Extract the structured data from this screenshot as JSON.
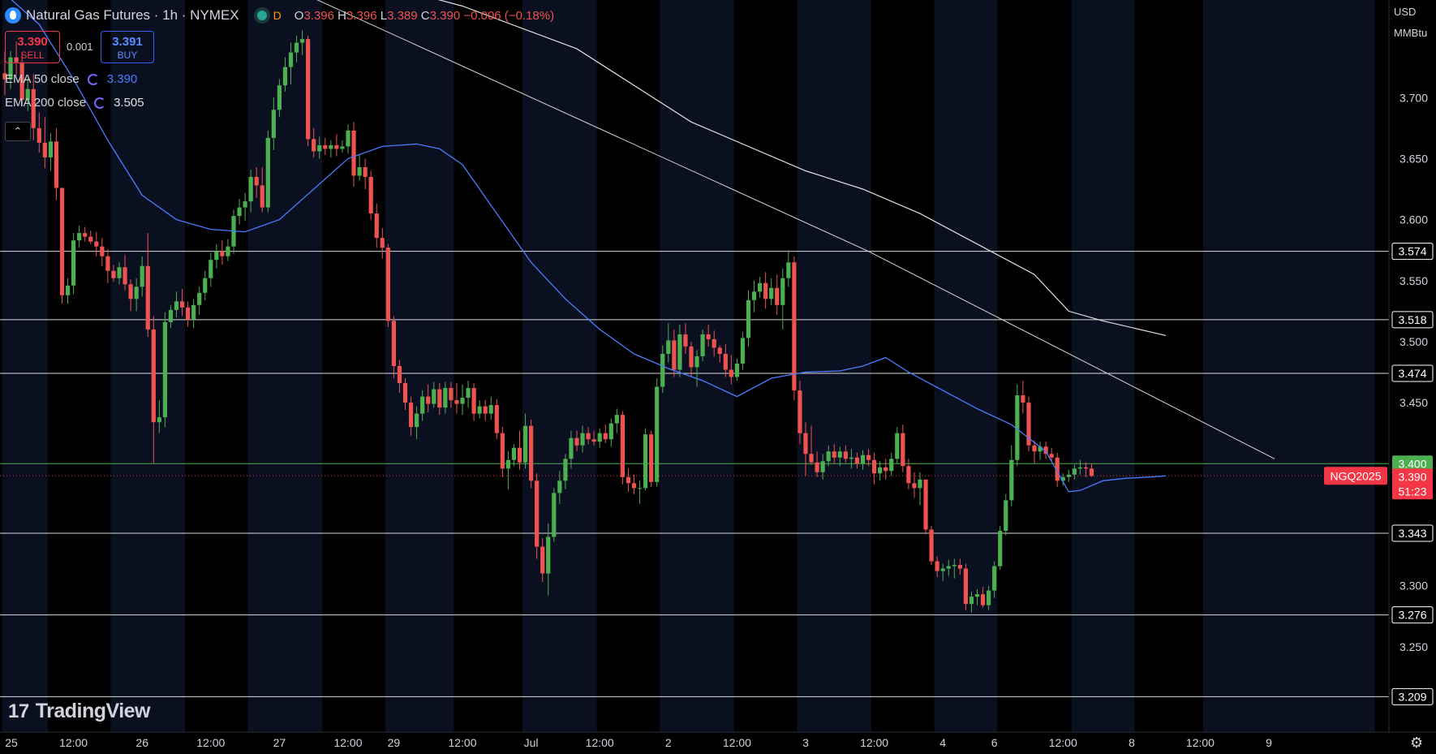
{
  "header": {
    "title": "Natural Gas Futures · 1h · NYMEX",
    "interval_badge": "D",
    "open_label": "O",
    "open": "3.396",
    "high_label": "H",
    "high": "3.396",
    "low_label": "L",
    "low": "3.389",
    "close_label": "C",
    "close": "3.390",
    "change": "−0.006 (−0.18%)"
  },
  "trade": {
    "sell_price": "3.390",
    "sell_label": "SELL",
    "spread": "0.001",
    "buy_price": "3.391",
    "buy_label": "BUY"
  },
  "indicators": [
    {
      "name": "EMA 50 close",
      "value": "3.390",
      "color": "#4a7dff"
    },
    {
      "name": "EMA 200 close",
      "value": "3.505",
      "color": "#e0e0e0"
    }
  ],
  "collapse_icon": "chevron-up-icon",
  "currency": "USD",
  "unit": "MMBtu",
  "watermark": "TradingView",
  "settings_icon": "gear-icon",
  "colors": {
    "up": "#26a69a",
    "up_body": "#4caf50",
    "down": "#ef5350",
    "session_bg": "#0b1020",
    "background": "#000000",
    "hline": "#ffffff",
    "current_line": "#4caf50",
    "last_price": "#f23645"
  },
  "chart_data": {
    "type": "candlestick",
    "symbol": "NGQ2025",
    "ylim": [
      3.18,
      3.78
    ],
    "y_ticks": [
      "3.700",
      "3.650",
      "3.600",
      "3.550",
      "3.500",
      "3.450",
      "3.300",
      "3.250"
    ],
    "x_ticks": [
      {
        "label": "25",
        "h": 0
      },
      {
        "label": "12:00",
        "h": 12
      },
      {
        "label": "26",
        "h": 24
      },
      {
        "label": "12:00",
        "h": 36
      },
      {
        "label": "27",
        "h": 48
      },
      {
        "label": "12:00",
        "h": 60
      },
      {
        "label": "29",
        "h": 68
      },
      {
        "label": "12:00",
        "h": 80
      },
      {
        "label": "Jul",
        "h": 92
      },
      {
        "label": "12:00",
        "h": 104
      },
      {
        "label": "2",
        "h": 116
      },
      {
        "label": "12:00",
        "h": 128
      },
      {
        "label": "3",
        "h": 140
      },
      {
        "label": "12:00",
        "h": 152
      },
      {
        "label": "4",
        "h": 164
      },
      {
        "label": "6",
        "h": 173
      },
      {
        "label": "12:00",
        "h": 185
      },
      {
        "label": "8",
        "h": 197
      },
      {
        "label": "12:00",
        "h": 209
      },
      {
        "label": "9",
        "h": 221
      }
    ],
    "session_breaks": [
      8,
      19,
      32,
      43,
      56,
      67,
      79,
      91,
      104,
      115,
      128,
      139,
      152,
      163,
      174,
      187,
      198,
      210
    ],
    "horizontal_levels": [
      "3.574",
      "3.518",
      "3.474",
      "3.343",
      "3.276",
      "3.209"
    ],
    "current_level": "3.400",
    "last_price": "3.390",
    "countdown": "51:23",
    "candles": [
      [
        3.72,
        3.738,
        3.702,
        3.715
      ],
      [
        3.715,
        3.738,
        3.707,
        3.733
      ],
      [
        3.733,
        3.746,
        3.718,
        3.729
      ],
      [
        3.729,
        3.737,
        3.693,
        3.698
      ],
      [
        3.698,
        3.716,
        3.689,
        3.707
      ],
      [
        3.707,
        3.719,
        3.665,
        3.675
      ],
      [
        3.675,
        3.688,
        3.655,
        3.663
      ],
      [
        3.663,
        3.684,
        3.642,
        3.651
      ],
      [
        3.651,
        3.671,
        3.64,
        3.664
      ],
      [
        3.664,
        3.675,
        3.616,
        3.626
      ],
      [
        3.626,
        3.626,
        3.531,
        3.538
      ],
      [
        3.538,
        3.552,
        3.531,
        3.546
      ],
      [
        3.546,
        3.589,
        3.539,
        3.583
      ],
      [
        3.583,
        3.595,
        3.577,
        3.589
      ],
      [
        3.589,
        3.594,
        3.582,
        3.586
      ],
      [
        3.586,
        3.591,
        3.58,
        3.582
      ],
      [
        3.582,
        3.59,
        3.57,
        3.578
      ],
      [
        3.578,
        3.585,
        3.562,
        3.57
      ],
      [
        3.57,
        3.576,
        3.548,
        3.558
      ],
      [
        3.558,
        3.563,
        3.549,
        3.552
      ],
      [
        3.552,
        3.565,
        3.547,
        3.561
      ],
      [
        3.561,
        3.571,
        3.542,
        3.547
      ],
      [
        3.547,
        3.551,
        3.525,
        3.535
      ],
      [
        3.535,
        3.552,
        3.525,
        3.545
      ],
      [
        3.545,
        3.57,
        3.537,
        3.562
      ],
      [
        3.562,
        3.589,
        3.504,
        3.51
      ],
      [
        3.51,
        3.521,
        3.4,
        3.434
      ],
      [
        3.434,
        3.452,
        3.425,
        3.438
      ],
      [
        3.438,
        3.524,
        3.43,
        3.516
      ],
      [
        3.516,
        3.53,
        3.511,
        3.526
      ],
      [
        3.526,
        3.541,
        3.52,
        3.533
      ],
      [
        3.533,
        3.543,
        3.521,
        3.528
      ],
      [
        3.528,
        3.533,
        3.512,
        3.518
      ],
      [
        3.518,
        3.535,
        3.511,
        3.53
      ],
      [
        3.53,
        3.545,
        3.522,
        3.54
      ],
      [
        3.54,
        3.558,
        3.534,
        3.552
      ],
      [
        3.552,
        3.573,
        3.545,
        3.567
      ],
      [
        3.567,
        3.58,
        3.56,
        3.574
      ],
      [
        3.574,
        3.583,
        3.563,
        3.57
      ],
      [
        3.57,
        3.584,
        3.566,
        3.578
      ],
      [
        3.578,
        3.608,
        3.572,
        3.603
      ],
      [
        3.603,
        3.617,
        3.596,
        3.61
      ],
      [
        3.61,
        3.622,
        3.599,
        3.615
      ],
      [
        3.615,
        3.641,
        3.606,
        3.635
      ],
      [
        3.635,
        3.643,
        3.618,
        3.628
      ],
      [
        3.628,
        3.643,
        3.606,
        3.61
      ],
      [
        3.61,
        3.673,
        3.606,
        3.667
      ],
      [
        3.667,
        3.7,
        3.657,
        3.69
      ],
      [
        3.69,
        3.715,
        3.684,
        3.71
      ],
      [
        3.71,
        3.733,
        3.705,
        3.725
      ],
      [
        3.725,
        3.745,
        3.711,
        3.737
      ],
      [
        3.737,
        3.751,
        3.729,
        3.745
      ],
      [
        3.745,
        3.755,
        3.735,
        3.748
      ],
      [
        3.748,
        3.751,
        3.66,
        3.666
      ],
      [
        3.666,
        3.675,
        3.651,
        3.656
      ],
      [
        3.656,
        3.668,
        3.65,
        3.661
      ],
      [
        3.661,
        3.667,
        3.653,
        3.658
      ],
      [
        3.658,
        3.665,
        3.651,
        3.661
      ],
      [
        3.661,
        3.67,
        3.652,
        3.658
      ],
      [
        3.658,
        3.665,
        3.655,
        3.66
      ],
      [
        3.66,
        3.678,
        3.654,
        3.673
      ],
      [
        3.673,
        3.68,
        3.627,
        3.636
      ],
      [
        3.636,
        3.653,
        3.632,
        3.643
      ],
      [
        3.643,
        3.65,
        3.625,
        3.635
      ],
      [
        3.635,
        3.64,
        3.6,
        3.605
      ],
      [
        3.605,
        3.613,
        3.577,
        3.585
      ],
      [
        3.585,
        3.593,
        3.568,
        3.577
      ],
      [
        3.577,
        3.58,
        3.512,
        3.517
      ],
      [
        3.517,
        3.521,
        3.47,
        3.48
      ],
      [
        3.48,
        3.485,
        3.458,
        3.466
      ],
      [
        3.466,
        3.47,
        3.444,
        3.45
      ],
      [
        3.45,
        3.455,
        3.423,
        3.43
      ],
      [
        3.43,
        3.447,
        3.42,
        3.441
      ],
      [
        3.441,
        3.46,
        3.435,
        3.455
      ],
      [
        3.455,
        3.465,
        3.442,
        3.449
      ],
      [
        3.449,
        3.467,
        3.446,
        3.461
      ],
      [
        3.461,
        3.466,
        3.44,
        3.446
      ],
      [
        3.446,
        3.467,
        3.441,
        3.462
      ],
      [
        3.462,
        3.467,
        3.446,
        3.452
      ],
      [
        3.452,
        3.466,
        3.441,
        3.449
      ],
      [
        3.449,
        3.465,
        3.44,
        3.454
      ],
      [
        3.454,
        3.468,
        3.446,
        3.462
      ],
      [
        3.462,
        3.466,
        3.435,
        3.441
      ],
      [
        3.441,
        3.452,
        3.437,
        3.447
      ],
      [
        3.447,
        3.452,
        3.435,
        3.441
      ],
      [
        3.441,
        3.455,
        3.436,
        3.448
      ],
      [
        3.448,
        3.453,
        3.42,
        3.425
      ],
      [
        3.425,
        3.43,
        3.389,
        3.396
      ],
      [
        3.396,
        3.41,
        3.379,
        3.403
      ],
      [
        3.403,
        3.416,
        3.398,
        3.413
      ],
      [
        3.413,
        3.427,
        3.395,
        3.401
      ],
      [
        3.401,
        3.441,
        3.396,
        3.431
      ],
      [
        3.431,
        3.436,
        3.38,
        3.386
      ],
      [
        3.386,
        3.392,
        3.322,
        3.332
      ],
      [
        3.332,
        3.339,
        3.303,
        3.31
      ],
      [
        3.31,
        3.351,
        3.292,
        3.34
      ],
      [
        3.34,
        3.38,
        3.336,
        3.376
      ],
      [
        3.376,
        3.394,
        3.367,
        3.386
      ],
      [
        3.386,
        3.408,
        3.379,
        3.404
      ],
      [
        3.404,
        3.427,
        3.396,
        3.421
      ],
      [
        3.421,
        3.427,
        3.41,
        3.415
      ],
      [
        3.415,
        3.431,
        3.409,
        3.425
      ],
      [
        3.425,
        3.43,
        3.416,
        3.42
      ],
      [
        3.42,
        3.427,
        3.415,
        3.418
      ],
      [
        3.418,
        3.429,
        3.413,
        3.425
      ],
      [
        3.425,
        3.432,
        3.417,
        3.42
      ],
      [
        3.42,
        3.437,
        3.414,
        3.433
      ],
      [
        3.433,
        3.445,
        3.425,
        3.44
      ],
      [
        3.44,
        3.443,
        3.383,
        3.389
      ],
      [
        3.389,
        3.396,
        3.377,
        3.384
      ],
      [
        3.384,
        3.391,
        3.375,
        3.38
      ],
      [
        3.38,
        3.386,
        3.367,
        3.38
      ],
      [
        3.38,
        3.429,
        3.378,
        3.424
      ],
      [
        3.424,
        3.427,
        3.381,
        3.385
      ],
      [
        3.385,
        3.47,
        3.381,
        3.463
      ],
      [
        3.463,
        3.497,
        3.458,
        3.49
      ],
      [
        3.49,
        3.515,
        3.483,
        3.501
      ],
      [
        3.501,
        3.51,
        3.471,
        3.477
      ],
      [
        3.477,
        3.514,
        3.471,
        3.506
      ],
      [
        3.506,
        3.515,
        3.49,
        3.496
      ],
      [
        3.496,
        3.5,
        3.471,
        3.479
      ],
      [
        3.479,
        3.493,
        3.463,
        3.488
      ],
      [
        3.488,
        3.51,
        3.484,
        3.506
      ],
      [
        3.506,
        3.514,
        3.496,
        3.502
      ],
      [
        3.502,
        3.509,
        3.488,
        3.495
      ],
      [
        3.495,
        3.497,
        3.483,
        3.49
      ],
      [
        3.49,
        3.498,
        3.471,
        3.477
      ],
      [
        3.477,
        3.489,
        3.465,
        3.471
      ],
      [
        3.471,
        3.486,
        3.468,
        3.482
      ],
      [
        3.482,
        3.508,
        3.477,
        3.503
      ],
      [
        3.503,
        3.542,
        3.496,
        3.534
      ],
      [
        3.534,
        3.55,
        3.524,
        3.541
      ],
      [
        3.541,
        3.553,
        3.536,
        3.548
      ],
      [
        3.548,
        3.557,
        3.527,
        3.535
      ],
      [
        3.535,
        3.552,
        3.53,
        3.544
      ],
      [
        3.544,
        3.555,
        3.522,
        3.53
      ],
      [
        3.53,
        3.56,
        3.51,
        3.552
      ],
      [
        3.552,
        3.575,
        3.545,
        3.565
      ],
      [
        3.565,
        3.57,
        3.452,
        3.46
      ],
      [
        3.46,
        3.468,
        3.416,
        3.425
      ],
      [
        3.425,
        3.434,
        3.39,
        3.408
      ],
      [
        3.408,
        3.431,
        3.399,
        3.401
      ],
      [
        3.401,
        3.41,
        3.389,
        3.393
      ],
      [
        3.393,
        3.408,
        3.387,
        3.402
      ],
      [
        3.402,
        3.415,
        3.398,
        3.41
      ],
      [
        3.41,
        3.416,
        3.4,
        3.405
      ],
      [
        3.405,
        3.414,
        3.398,
        3.41
      ],
      [
        3.41,
        3.415,
        3.401,
        3.404
      ],
      [
        3.404,
        3.412,
        3.396,
        3.405
      ],
      [
        3.405,
        3.409,
        3.396,
        3.4
      ],
      [
        3.4,
        3.411,
        3.395,
        3.407
      ],
      [
        3.407,
        3.412,
        3.398,
        3.403
      ],
      [
        3.403,
        3.409,
        3.383,
        3.392
      ],
      [
        3.392,
        3.402,
        3.386,
        3.397
      ],
      [
        3.397,
        3.404,
        3.387,
        3.394
      ],
      [
        3.394,
        3.409,
        3.39,
        3.404
      ],
      [
        3.404,
        3.43,
        3.4,
        3.425
      ],
      [
        3.425,
        3.432,
        3.393,
        3.398
      ],
      [
        3.398,
        3.404,
        3.379,
        3.384
      ],
      [
        3.384,
        3.393,
        3.372,
        3.38
      ],
      [
        3.38,
        3.393,
        3.366,
        3.387
      ],
      [
        3.387,
        3.349,
        3.342,
        3.346
      ],
      [
        3.346,
        3.349,
        3.317,
        3.32
      ],
      [
        3.32,
        3.324,
        3.307,
        3.312
      ],
      [
        3.312,
        3.318,
        3.304,
        3.314
      ],
      [
        3.314,
        3.321,
        3.308,
        3.316
      ],
      [
        3.316,
        3.322,
        3.306,
        3.317
      ],
      [
        3.317,
        3.322,
        3.309,
        3.314
      ],
      [
        3.314,
        3.318,
        3.28,
        3.285
      ],
      [
        3.285,
        3.295,
        3.278,
        3.291
      ],
      [
        3.291,
        3.297,
        3.284,
        3.293
      ],
      [
        3.293,
        3.299,
        3.282,
        3.284
      ],
      [
        3.284,
        3.3,
        3.28,
        3.296
      ],
      [
        3.296,
        3.32,
        3.29,
        3.316
      ],
      [
        3.316,
        3.349,
        3.313,
        3.345
      ],
      [
        3.345,
        3.375,
        3.341,
        3.37
      ],
      [
        3.37,
        3.415,
        3.365,
        3.403
      ],
      [
        3.403,
        3.465,
        3.398,
        3.456
      ],
      [
        3.456,
        3.468,
        3.441,
        3.45
      ],
      [
        3.45,
        3.455,
        3.41,
        3.415
      ],
      [
        3.415,
        3.419,
        3.4,
        3.41
      ],
      [
        3.41,
        3.418,
        3.403,
        3.414
      ],
      [
        3.414,
        3.418,
        3.404,
        3.408
      ],
      [
        3.408,
        3.413,
        3.402,
        3.405
      ],
      [
        3.405,
        3.409,
        3.381,
        3.386
      ],
      [
        3.386,
        3.392,
        3.382,
        3.389
      ],
      [
        3.389,
        3.395,
        3.385,
        3.391
      ],
      [
        3.391,
        3.399,
        3.387,
        3.396
      ],
      [
        3.396,
        3.403,
        3.391,
        3.397
      ],
      [
        3.397,
        3.401,
        3.389,
        3.396
      ],
      [
        3.396,
        3.4,
        3.389,
        3.39
      ]
    ],
    "ema50": [
      [
        0,
        3.785
      ],
      [
        6,
        3.76
      ],
      [
        12,
        3.715
      ],
      [
        18,
        3.665
      ],
      [
        24,
        3.62
      ],
      [
        30,
        3.6
      ],
      [
        36,
        3.592
      ],
      [
        42,
        3.59
      ],
      [
        48,
        3.6
      ],
      [
        54,
        3.625
      ],
      [
        60,
        3.65
      ],
      [
        66,
        3.66
      ],
      [
        72,
        3.662
      ],
      [
        76,
        3.658
      ],
      [
        80,
        3.645
      ],
      [
        86,
        3.605
      ],
      [
        92,
        3.565
      ],
      [
        98,
        3.535
      ],
      [
        104,
        3.51
      ],
      [
        110,
        3.49
      ],
      [
        116,
        3.478
      ],
      [
        122,
        3.468
      ],
      [
        128,
        3.455
      ],
      [
        134,
        3.47
      ],
      [
        140,
        3.475
      ],
      [
        146,
        3.476
      ],
      [
        150,
        3.48
      ],
      [
        154,
        3.487
      ],
      [
        158,
        3.475
      ],
      [
        164,
        3.46
      ],
      [
        170,
        3.445
      ],
      [
        176,
        3.432
      ],
      [
        182,
        3.41
      ],
      [
        186,
        3.377
      ],
      [
        188,
        3.378
      ],
      [
        192,
        3.386
      ],
      [
        196,
        3.388
      ],
      [
        200,
        3.389
      ],
      [
        203,
        3.39
      ]
    ],
    "ema200": [
      [
        22,
        3.875
      ],
      [
        40,
        3.835
      ],
      [
        60,
        3.8
      ],
      [
        80,
        3.775
      ],
      [
        100,
        3.74
      ],
      [
        120,
        3.68
      ],
      [
        140,
        3.64
      ],
      [
        150,
        3.625
      ],
      [
        160,
        3.605
      ],
      [
        170,
        3.58
      ],
      [
        180,
        3.555
      ],
      [
        186,
        3.525
      ],
      [
        192,
        3.517
      ],
      [
        203,
        3.505
      ]
    ],
    "trendline": [
      [
        50,
        3.79
      ],
      [
        151,
        3.574
      ],
      [
        222,
        3.404
      ]
    ]
  }
}
